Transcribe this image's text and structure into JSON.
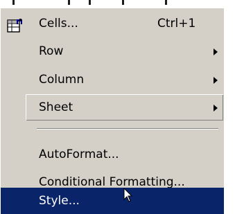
{
  "menu": {
    "items": [
      {
        "label": "Cells...",
        "shortcut": "Ctrl+1",
        "icon": "format-cells-icon",
        "has_submenu": false
      },
      {
        "label": "Row",
        "shortcut": "",
        "has_submenu": true
      },
      {
        "label": "Column",
        "shortcut": "",
        "has_submenu": true
      },
      {
        "label": "Sheet",
        "shortcut": "",
        "has_submenu": true
      },
      {
        "label": "AutoFormat...",
        "shortcut": "",
        "has_submenu": false
      },
      {
        "label": "Conditional Formatting...",
        "shortcut": "",
        "has_submenu": false
      },
      {
        "label": "Style...",
        "shortcut": "",
        "has_submenu": false,
        "selected": true
      }
    ]
  },
  "colors": {
    "menu_bg": "#d4d0c8",
    "highlight": "#0a246a",
    "highlight_text": "#ffffff",
    "text": "#000000"
  },
  "cursor": "mouse-pointer-icon"
}
